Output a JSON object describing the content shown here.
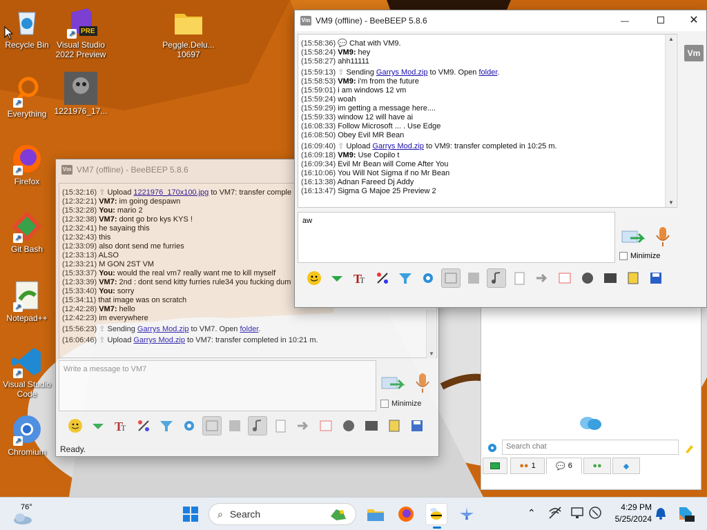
{
  "desktop": {
    "icons": [
      {
        "label": "Recycle Bin",
        "icon": "recycle-bin-icon"
      },
      {
        "label": "Visual Studio 2022 Preview",
        "icon": "visual-studio-preview-icon",
        "badge": "PRE"
      },
      {
        "label": "Peggle.Delu... 10697",
        "icon": "folder-icon"
      },
      {
        "label": "Everything",
        "icon": "everything-search-icon"
      },
      {
        "label": "1221976_17...",
        "icon": "image-file-icon"
      },
      {
        "label": "Firefox",
        "icon": "firefox-icon"
      },
      {
        "label": "Git Bash",
        "icon": "git-bash-icon"
      },
      {
        "label": "Notepad++",
        "icon": "notepadpp-icon"
      },
      {
        "label": "Visual Studio Code",
        "icon": "vscode-icon"
      },
      {
        "label": "Chromium",
        "icon": "chromium-icon"
      }
    ]
  },
  "vm7_window": {
    "title": "VM7 (offline) - BeeBEEP 5.8.6",
    "lines": [
      {
        "ts": "(15:32:16)",
        "icon": "upload",
        "text": "Upload ",
        "link": "1221976_170x100.jpg",
        "after": " to VM7: transfer comple"
      },
      {
        "ts": "(12:32:21)",
        "who": "VM7:",
        "text": " im going despawn"
      },
      {
        "ts": "(15:32:28)",
        "who": "You:",
        "text": " mario 2"
      },
      {
        "ts": "(12:32:38)",
        "who": "VM7:",
        "text": " dont   go bro kys KYS !"
      },
      {
        "ts": "(12:32:41)",
        "text": "   he sayaing this"
      },
      {
        "ts": "(12:32:43)",
        "text": "   this"
      },
      {
        "ts": "(12:33:09)",
        "text": "   also dont send me furries"
      },
      {
        "ts": "(12:33:13)",
        "text": "   ALSO"
      },
      {
        "ts": "(12:33:21)",
        "text": "   M GON 2ST VM"
      },
      {
        "ts": "(15:33:37)",
        "who": "You:",
        "text": " would the real vm7 really want me to kill myself"
      },
      {
        "ts": "(12:33:39)",
        "who": "VM7:",
        "text": " 2nd : dont send kitty furries rule34 you fucking dum"
      },
      {
        "ts": "(15:33:40)",
        "who": "You:",
        "text": " sorry"
      },
      {
        "ts": "(15:34:11)",
        "text": "   that image was on scratch"
      },
      {
        "ts": "(12:42:28)",
        "who": "VM7:",
        "text": " hello"
      },
      {
        "ts": "(12:42:23)",
        "text": "   im everywhere"
      },
      {
        "ts": "(15:56:23)",
        "icon": "send",
        "text": "Sending ",
        "link": "Garrys Mod.zip",
        "after": " to VM7. Open ",
        "link2": "folder",
        "after2": "."
      },
      {
        "ts": "(16:06:46)",
        "icon": "upload",
        "text": "Upload ",
        "link": "Garrys Mod.zip",
        "after": " to VM7: transfer completed in 10:21 m."
      }
    ],
    "input_placeholder": "Write a message to VM7",
    "minimize_label": "Minimize",
    "status": "Ready."
  },
  "vm9_window": {
    "title": "VM9 (offline) - BeeBEEP 5.8.6",
    "lines": [
      {
        "ts": "(15:58:36)",
        "icon": "chat",
        "text": "Chat with VM9."
      },
      {
        "ts": "(15:58:24)",
        "who": "VM9:",
        "text": " hey"
      },
      {
        "ts": "(15:58:27)",
        "text": "   ahh11111"
      },
      {
        "ts": "(15:59:13)",
        "icon": "send",
        "text": "Sending ",
        "link": "Garrys Mod.zip",
        "after": " to VM9. Open ",
        "link2": "folder",
        "after2": "."
      },
      {
        "ts": "(15:58:53)",
        "who": "VM9:",
        "text": " i'm from the future"
      },
      {
        "ts": "(15:59:01)",
        "text": "   i am windows 12 vm"
      },
      {
        "ts": "(15:59:24)",
        "text": "   woah"
      },
      {
        "ts": "(15:59:29)",
        "text": "   im getting a message here...."
      },
      {
        "ts": "(15:59:33)",
        "text": "   window 12 will have ai"
      },
      {
        "ts": "(16:08:33)",
        "text": "   Follow Microsoft ... . Use Edge"
      },
      {
        "ts": "(16:08:50)",
        "text": "   Obey Evil MR Bean"
      },
      {
        "ts": "(16:09:40)",
        "icon": "upload",
        "text": "Upload ",
        "link": "Garrys Mod.zip",
        "after": " to VM9: transfer completed in 10:25 m."
      },
      {
        "ts": "(16:09:18)",
        "who": "VM9:",
        "text": " Use Copilo t"
      },
      {
        "ts": "(16:09:34)",
        "text": "   Evil Mr Bean will Come After You"
      },
      {
        "ts": "(16:10:06)",
        "text": "   You Will Not Sigma if no Mr Bean"
      },
      {
        "ts": "(16:13:38)",
        "text": "   Adnan Fareed Dj Addy"
      },
      {
        "ts": "(16:13:47)",
        "text": "   Sigma G Majoe 25 Preview 2"
      }
    ],
    "input_value": "aw",
    "minimize_label": "Minimize",
    "side_logo": "Vm"
  },
  "side_panel": {
    "search_placeholder": "Search chat",
    "tabs": [
      {
        "icon": "network-icon",
        "count": ""
      },
      {
        "icon": "users-icon",
        "count": "1"
      },
      {
        "icon": "chats-icon",
        "count": "6"
      },
      {
        "icon": "groups-icon",
        "count": ""
      },
      {
        "icon": "shares-icon",
        "count": ""
      }
    ]
  },
  "taskbar": {
    "weather_temp": "76°",
    "search_label": "Search",
    "time": "4:29 PM",
    "date": "5/25/2024"
  },
  "colors": {
    "accent": "#0078d4",
    "link": "#1a0dab",
    "wallpaper": "#c8650e"
  }
}
